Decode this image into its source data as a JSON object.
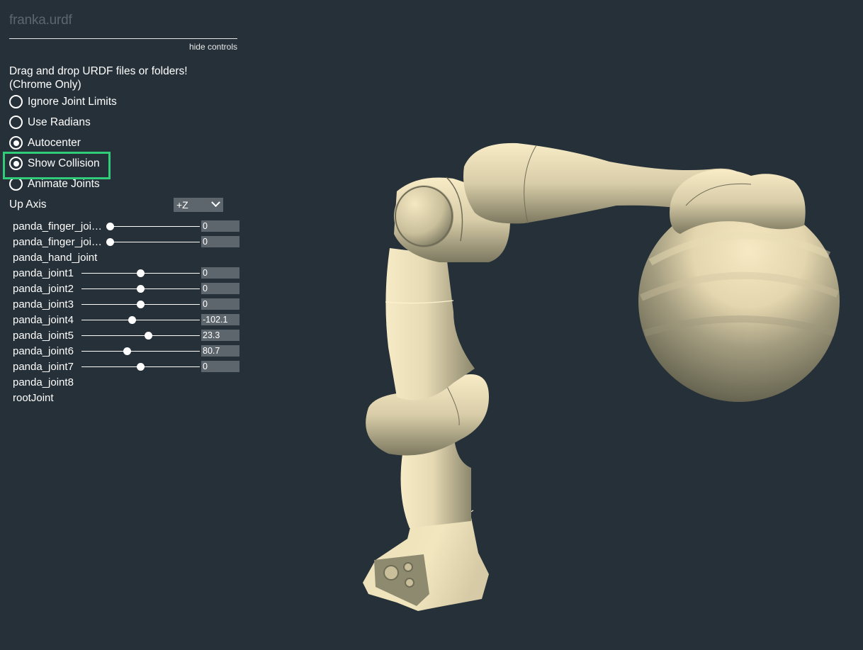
{
  "app": {
    "title": "franka.urdf",
    "hide_controls_label": "hide controls",
    "drop_message_line1": "Drag and drop URDF files or folders!",
    "drop_message_line2": "(Chrome Only)"
  },
  "toggles": [
    {
      "label": "Ignore Joint Limits",
      "checked": false
    },
    {
      "label": "Use Radians",
      "checked": false
    },
    {
      "label": "Autocenter",
      "checked": true
    },
    {
      "label": "Show Collision",
      "checked": true,
      "highlighted": true
    },
    {
      "label": "Animate Joints",
      "checked": false
    }
  ],
  "up_axis": {
    "label": "Up Axis",
    "selected": "+Z"
  },
  "joints": [
    {
      "name": "panda_finger_joi…",
      "has_slider": true,
      "value": "0",
      "position": 0.0,
      "short": true
    },
    {
      "name": "panda_finger_joi…",
      "has_slider": true,
      "value": "0",
      "position": 0.0,
      "short": true
    },
    {
      "name": "panda_hand_joint",
      "has_slider": false
    },
    {
      "name": "panda_joint1",
      "has_slider": true,
      "value": "0",
      "position": 0.5
    },
    {
      "name": "panda_joint2",
      "has_slider": true,
      "value": "0",
      "position": 0.5
    },
    {
      "name": "panda_joint3",
      "has_slider": true,
      "value": "0",
      "position": 0.5
    },
    {
      "name": "panda_joint4",
      "has_slider": true,
      "value": "-102.1",
      "position": 0.43
    },
    {
      "name": "panda_joint5",
      "has_slider": true,
      "value": "23.3",
      "position": 0.565
    },
    {
      "name": "panda_joint6",
      "has_slider": true,
      "value": "80.7",
      "position": 0.385
    },
    {
      "name": "panda_joint7",
      "has_slider": true,
      "value": "0",
      "position": 0.5
    },
    {
      "name": "panda_joint8",
      "has_slider": false
    },
    {
      "name": "rootJoint",
      "has_slider": false
    }
  ],
  "colors": {
    "background": "#263038",
    "robot": "#f2e6bf",
    "highlight": "#31cc7a",
    "input_bg": "#5d666d"
  }
}
